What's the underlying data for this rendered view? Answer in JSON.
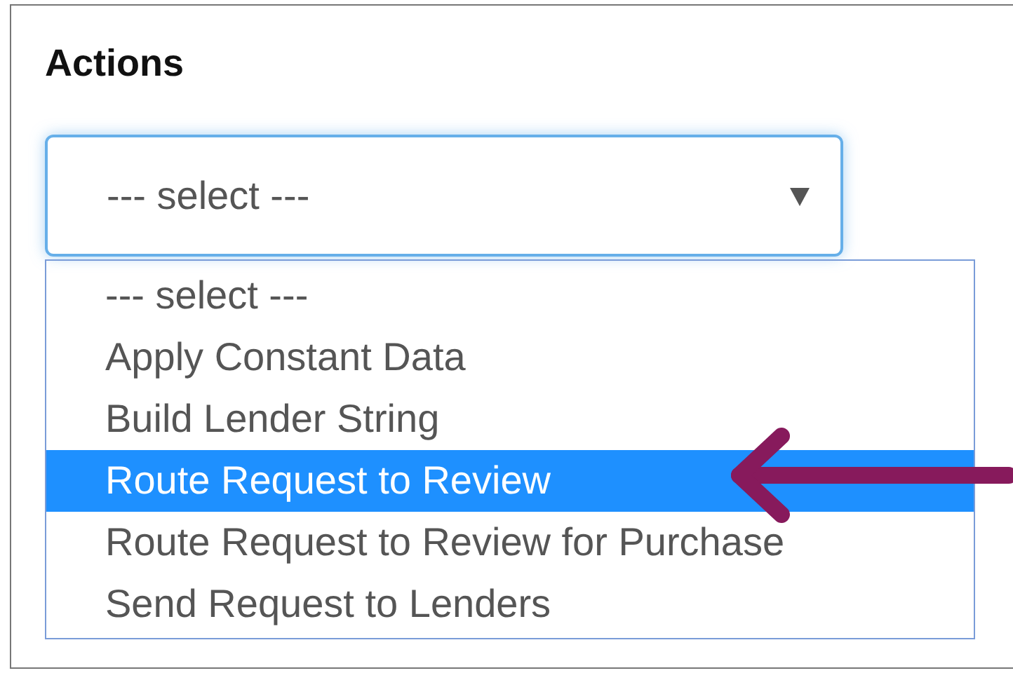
{
  "section": {
    "title": "Actions"
  },
  "select": {
    "value": "--- select ---",
    "open": true
  },
  "options": [
    {
      "label": "--- select ---",
      "selected": false
    },
    {
      "label": "Apply Constant Data",
      "selected": false
    },
    {
      "label": "Build Lender String",
      "selected": false
    },
    {
      "label": "Route Request to Review",
      "selected": true
    },
    {
      "label": "Route Request to Review for Purchase",
      "selected": false
    },
    {
      "label": "Send Request to Lenders",
      "selected": false
    }
  ]
}
